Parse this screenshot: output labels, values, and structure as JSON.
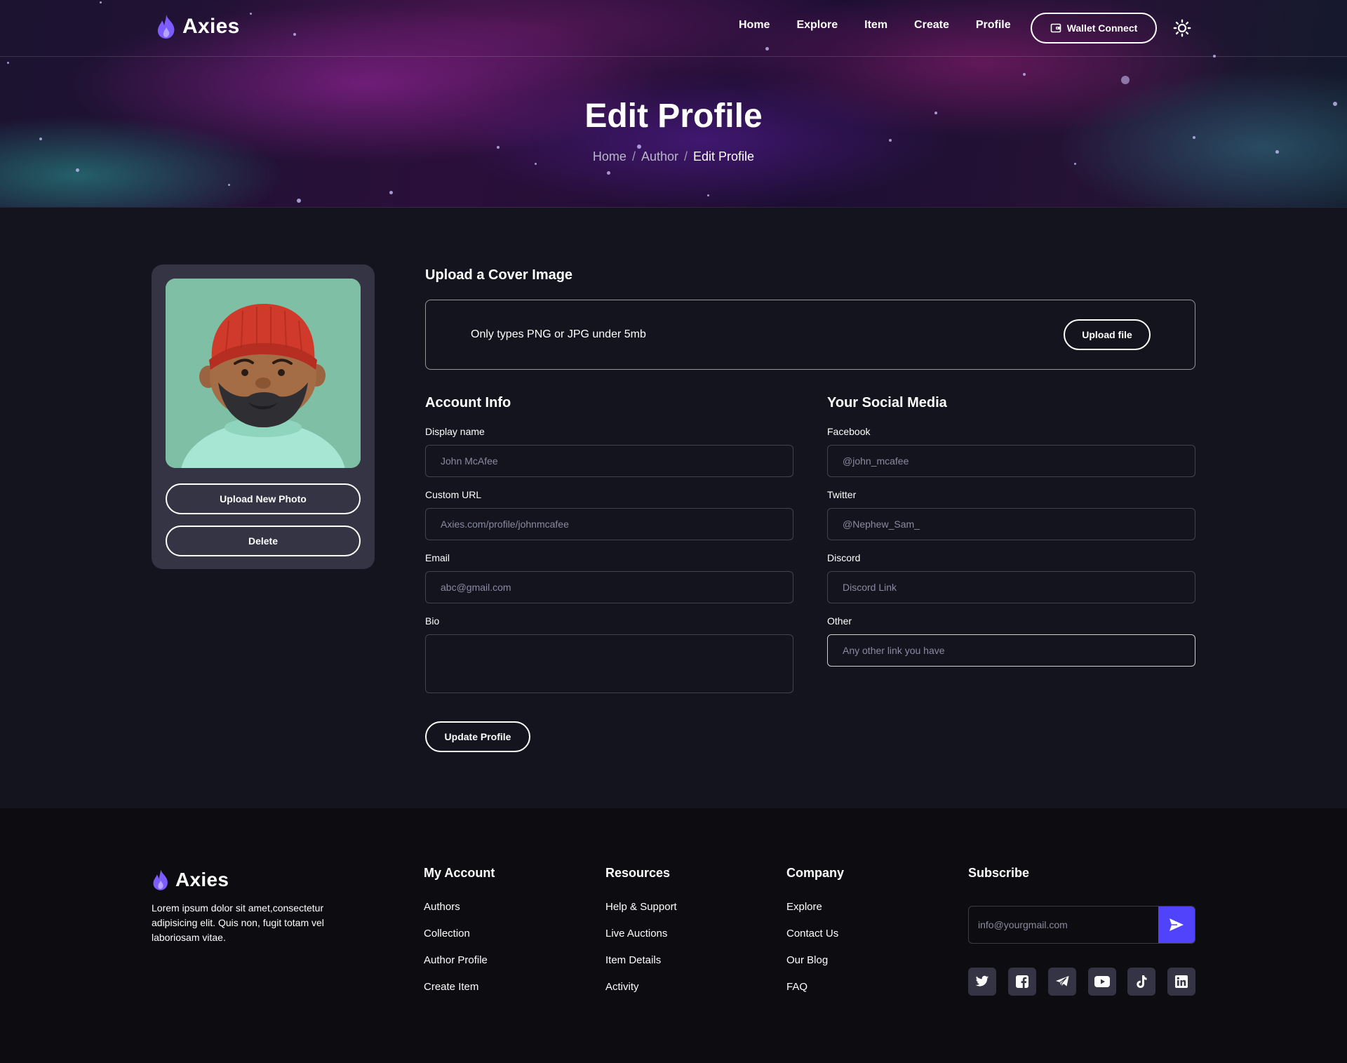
{
  "brand": {
    "name": "Axies",
    "accent": "#5142fc",
    "flame_color": "#7c5cff"
  },
  "nav": {
    "links": [
      "Home",
      "Explore",
      "Item",
      "Create",
      "Profile"
    ],
    "wallet_label": "Wallet Connect"
  },
  "hero": {
    "title": "Edit Profile",
    "breadcrumb": [
      "Home",
      "Author",
      "Edit Profile"
    ]
  },
  "profile_card": {
    "upload_label": "Upload New Photo",
    "delete_label": "Delete"
  },
  "cover": {
    "title": "Upload a Cover Image",
    "hint": "Only types PNG or JPG under 5mb",
    "button": "Upload file"
  },
  "account": {
    "title": "Account Info",
    "display_name": {
      "label": "Display name",
      "placeholder": "John McAfee"
    },
    "custom_url": {
      "label": "Custom URL",
      "placeholder": "Axies.com/profile/johnmcafee"
    },
    "email": {
      "label": "Email",
      "placeholder": "abc@gmail.com"
    },
    "bio": {
      "label": "Bio",
      "placeholder": ""
    }
  },
  "social_media": {
    "title": "Your Social Media",
    "facebook": {
      "label": "Facebook",
      "placeholder": "@john_mcafee"
    },
    "twitter": {
      "label": "Twitter",
      "placeholder": "@Nephew_Sam_"
    },
    "discord": {
      "label": "Discord",
      "placeholder": "Discord Link"
    },
    "other": {
      "label": "Other",
      "placeholder": "Any other link you have"
    }
  },
  "update_label": "Update Profile",
  "footer": {
    "description": "Lorem ipsum dolor sit amet,consectetur adipisicing elit. Quis non, fugit totam vel laboriosam vitae.",
    "columns": [
      {
        "title": "My Account",
        "links": [
          "Authors",
          "Collection",
          "Author Profile",
          "Create Item"
        ]
      },
      {
        "title": "Resources",
        "links": [
          "Help & Support",
          "Live Auctions",
          "Item Details",
          "Activity"
        ]
      },
      {
        "title": "Company",
        "links": [
          "Explore",
          "Contact Us",
          "Our Blog",
          "FAQ"
        ]
      }
    ],
    "subscribe": {
      "title": "Subscribe",
      "placeholder": "info@yourgmail.com"
    },
    "social_icons": [
      "twitter-icon",
      "facebook-icon",
      "telegram-icon",
      "youtube-icon",
      "tiktok-icon",
      "linkedin-icon"
    ]
  }
}
